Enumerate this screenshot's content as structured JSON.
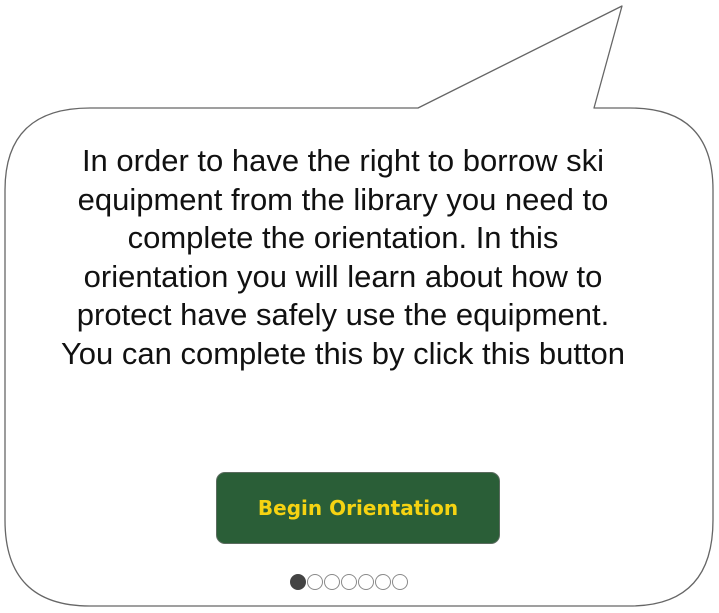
{
  "bubble": {
    "message": "In order to have the right to borrow ski equipment from the library you need to complete the orientation. In this orientation you will learn about how to protect have safely use the equipment. You can complete this by click this button"
  },
  "actions": {
    "begin_label": "Begin Orientation"
  },
  "pager": {
    "total_pages": 7,
    "current_page": 1
  },
  "colors": {
    "button_background": "#2a5e37",
    "button_text": "#f5d312",
    "bubble_stroke": "#666666",
    "dot_active": "#444444",
    "dot_inactive_border": "#8a8a8a"
  }
}
